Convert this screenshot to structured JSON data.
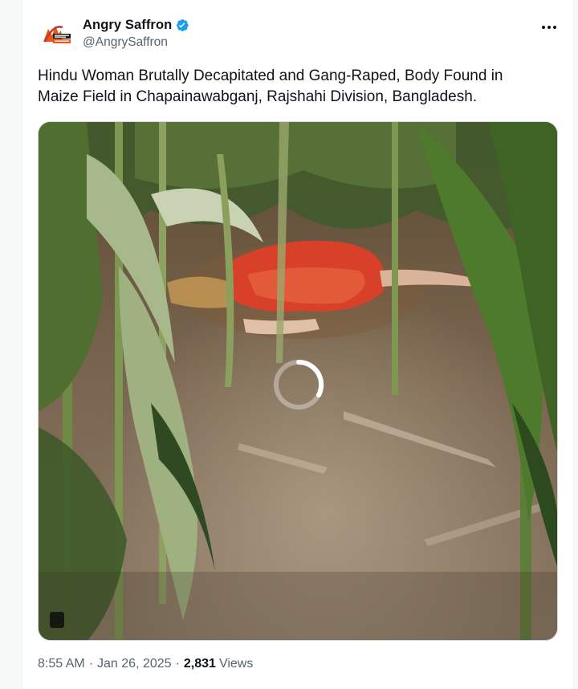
{
  "tweet": {
    "author": {
      "display_name": "Angry Saffron",
      "handle": "@AngrySaffron",
      "verified": true,
      "avatar_icon": "angry-saffron-logo"
    },
    "more_icon": "more-horizontal-icon",
    "text": "Hindu Woman Brutally Decapitated and Gang-Raped, Body Found in Maize Field in Chapainawabganj, Rajshahi Division, Bangladesh.",
    "media": {
      "type": "video",
      "state": "loading",
      "spinner_icon": "loading-spinner-icon",
      "control_icon": "pause-icon"
    },
    "time": "8:55 AM",
    "date": "Jan 26, 2025",
    "views_count": "2,831",
    "views_label": "Views",
    "separator": "·"
  },
  "colors": {
    "text_primary": "#0f1419",
    "text_secondary": "#536471",
    "verified_blue": "#1d9bf0",
    "border": "#cfd9de"
  }
}
